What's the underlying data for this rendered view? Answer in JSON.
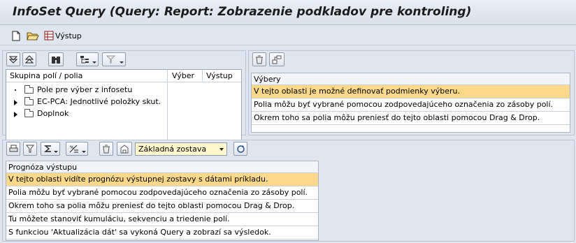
{
  "window": {
    "title": "InfoSet Query (Query: Report: Zobrazenie podkladov pre kontroling)"
  },
  "app_toolbar": {
    "output_label": "Výstup"
  },
  "field_tree": {
    "headers": {
      "group": "Skupina polí / polia",
      "selection": "Výber",
      "output": "Výstup"
    },
    "rows": [
      {
        "label": "Pole pre výber z infosetu",
        "expander": "dot"
      },
      {
        "label": "EC-PCA: Jednotlivé položky skut.",
        "expander": "triangle"
      },
      {
        "label": "Doplnok",
        "expander": "triangle"
      }
    ]
  },
  "selections": {
    "header": "Výbery",
    "rows": [
      "V tejto oblasti je možné definovať podmienky výberu.",
      "Polia môžu byť vybrané pomocou zodpovedajúceho označenia zo zásoby polí.",
      "Okrem toho sa polia môžu preniesť do tejto oblasti pomocou Drag & Drop."
    ]
  },
  "output_preview": {
    "layout_select": "Základná zostava",
    "header": "Prognóza výstupu",
    "rows": [
      "V tejto oblasti vidíte prognózu výstupnej zostavy s dátami príkladu.",
      "Polia môžu byť vybrané pomocou zodpovedajúceho označenia zo zásoby polí.",
      "Okrem toho sa polia môžu preniesť do tejto oblasti pomocou Drag & Drop.",
      "Tu môžete stanoviť kumuláciu, sekvenciu a triedenie polí.",
      "S funkciou 'Aktualizácia dát' sa vykoná Query a zobrazí sa výsledok."
    ]
  },
  "colors": {
    "background": "#dfe6ef",
    "selected_row": "#fbd88a",
    "dropdown": "#fff8cc"
  }
}
